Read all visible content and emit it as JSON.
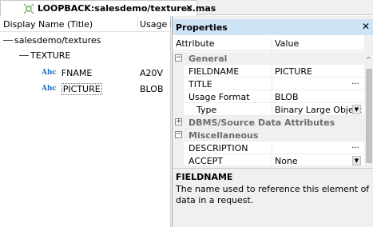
{
  "tab": {
    "title": "LOOPBACK:salesdemo/textures.mas",
    "close": "✕",
    "icon": "loopback-icon"
  },
  "tree": {
    "columns": {
      "name": "Display Name (Title)",
      "usage": "Usage Fo"
    },
    "nodes": [
      {
        "label": "salesdemo/textures",
        "value": ""
      },
      {
        "label": "TEXTURE",
        "value": ""
      },
      {
        "label": "FNAME",
        "value": "A20V",
        "icon": "Abc"
      },
      {
        "label": "PICTURE",
        "value": "BLOB",
        "icon": "Abc"
      }
    ]
  },
  "properties": {
    "title": "Properties",
    "close": "✕",
    "columns": {
      "attribute": "Attribute",
      "value": "Value"
    },
    "rows": [
      {
        "kind": "category",
        "name": "General",
        "toggle": "−"
      },
      {
        "kind": "prop",
        "name": "FIELDNAME",
        "value": "PICTURE"
      },
      {
        "kind": "prop",
        "name": "TITLE",
        "value": "",
        "button": "..."
      },
      {
        "kind": "prop",
        "name": "Usage Format",
        "value": "BLOB"
      },
      {
        "kind": "prop",
        "name": "Type",
        "value": "Binary Large Object",
        "dropdown": "▼"
      },
      {
        "kind": "category",
        "name": "DBMS/Source Data Attributes",
        "toggle": "+"
      },
      {
        "kind": "category",
        "name": "Miscellaneous",
        "toggle": "−"
      },
      {
        "kind": "prop",
        "name": "DESCRIPTION",
        "value": "",
        "button": "..."
      },
      {
        "kind": "prop",
        "name": "ACCEPT",
        "value": "None",
        "dropdown": "▼"
      }
    ],
    "scroll_up": "^",
    "description": {
      "title": "FIELDNAME",
      "text": "The name used to reference this element of data in a request."
    }
  }
}
